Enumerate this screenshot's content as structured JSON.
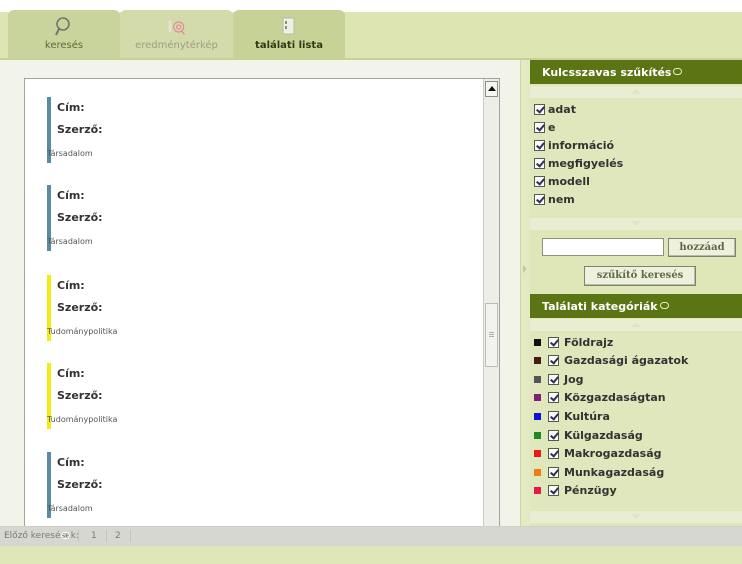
{
  "tabs": [
    {
      "label": "keresés",
      "icon": "magnifier-icon",
      "active": false
    },
    {
      "label": "eredménytérkép",
      "icon": "target-map-icon",
      "active": false
    },
    {
      "label": "találati lista",
      "icon": "document-list-icon",
      "active": true
    }
  ],
  "results": [
    {
      "title_label": "Cím:",
      "author_label": "Szerző:",
      "category": "Társadalom",
      "color": "#5b8aa3"
    },
    {
      "title_label": "Cím:",
      "author_label": "Szerző:",
      "category": "Társadalom",
      "color": "#5b8aa3"
    },
    {
      "title_label": "Cím:",
      "author_label": "Szerző:",
      "category": "Tudománypolitika",
      "color": "#f2ec10"
    },
    {
      "title_label": "Cím:",
      "author_label": "Szerző:",
      "category": "Tudománypolitika",
      "color": "#f2ec10"
    },
    {
      "title_label": "Cím:",
      "author_label": "Szerző:",
      "category": "Társadalom",
      "color": "#5b8aa3"
    }
  ],
  "keywords_panel": {
    "title": "Kulcsszavas szűkítés",
    "items": [
      "adat",
      "e",
      "információ",
      "megfigyelés",
      "modell",
      "nem"
    ],
    "input_value": "",
    "add_label": "hozzáad",
    "narrow_label": "szűkítő keresés"
  },
  "categories_panel": {
    "title": "Találati kategóriák",
    "items": [
      {
        "label": "Földrajz",
        "color": "#111111"
      },
      {
        "label": "Gazdasági ágazatok",
        "color": "#4a1a12"
      },
      {
        "label": "Jog",
        "color": "#555555"
      },
      {
        "label": "Közgazdaságtan",
        "color": "#7a1f7a"
      },
      {
        "label": "Kultúra",
        "color": "#1010d8"
      },
      {
        "label": "Külgazdaság",
        "color": "#1e8a1e"
      },
      {
        "label": "Makrogazdaság",
        "color": "#ee1a12"
      },
      {
        "label": "Munkagazdaság",
        "color": "#f07d10"
      },
      {
        "label": "Pénzügy",
        "color": "#e8144a"
      }
    ]
  },
  "bottom": {
    "previous_label": "Előző keresések:",
    "pages": [
      "1",
      "2"
    ]
  }
}
